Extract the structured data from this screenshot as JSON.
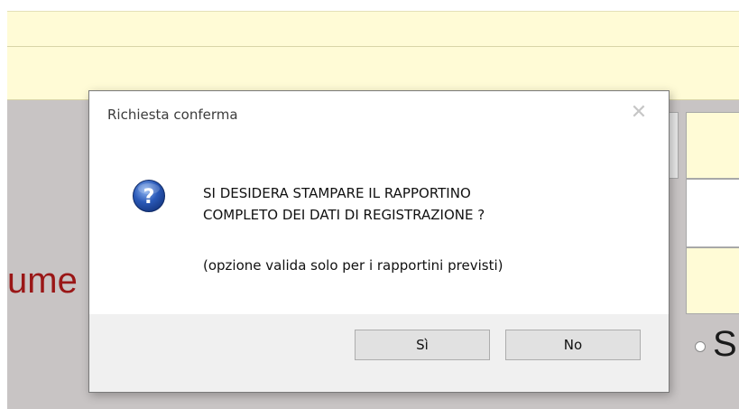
{
  "background": {
    "label_text": "ume",
    "radio_text": "S"
  },
  "dialog": {
    "title": "Richiesta conferma",
    "close_glyph": "✕",
    "icon": "question-icon",
    "message_line1": "SI DESIDERA STAMPARE IL RAPPORTINO",
    "message_line2": "COMPLETO DEI DATI DI REGISTRAZIONE ?",
    "note": "(opzione valida solo per i rapportini previsti)",
    "yes_label": "Sì",
    "no_label": "No"
  },
  "colors": {
    "dialog_background": "#ffffff",
    "dialog_footer": "#f0f0f0",
    "background_yellow": "#fffbd6",
    "label_red": "#9a1717",
    "question_blue": "#2a59b8"
  }
}
